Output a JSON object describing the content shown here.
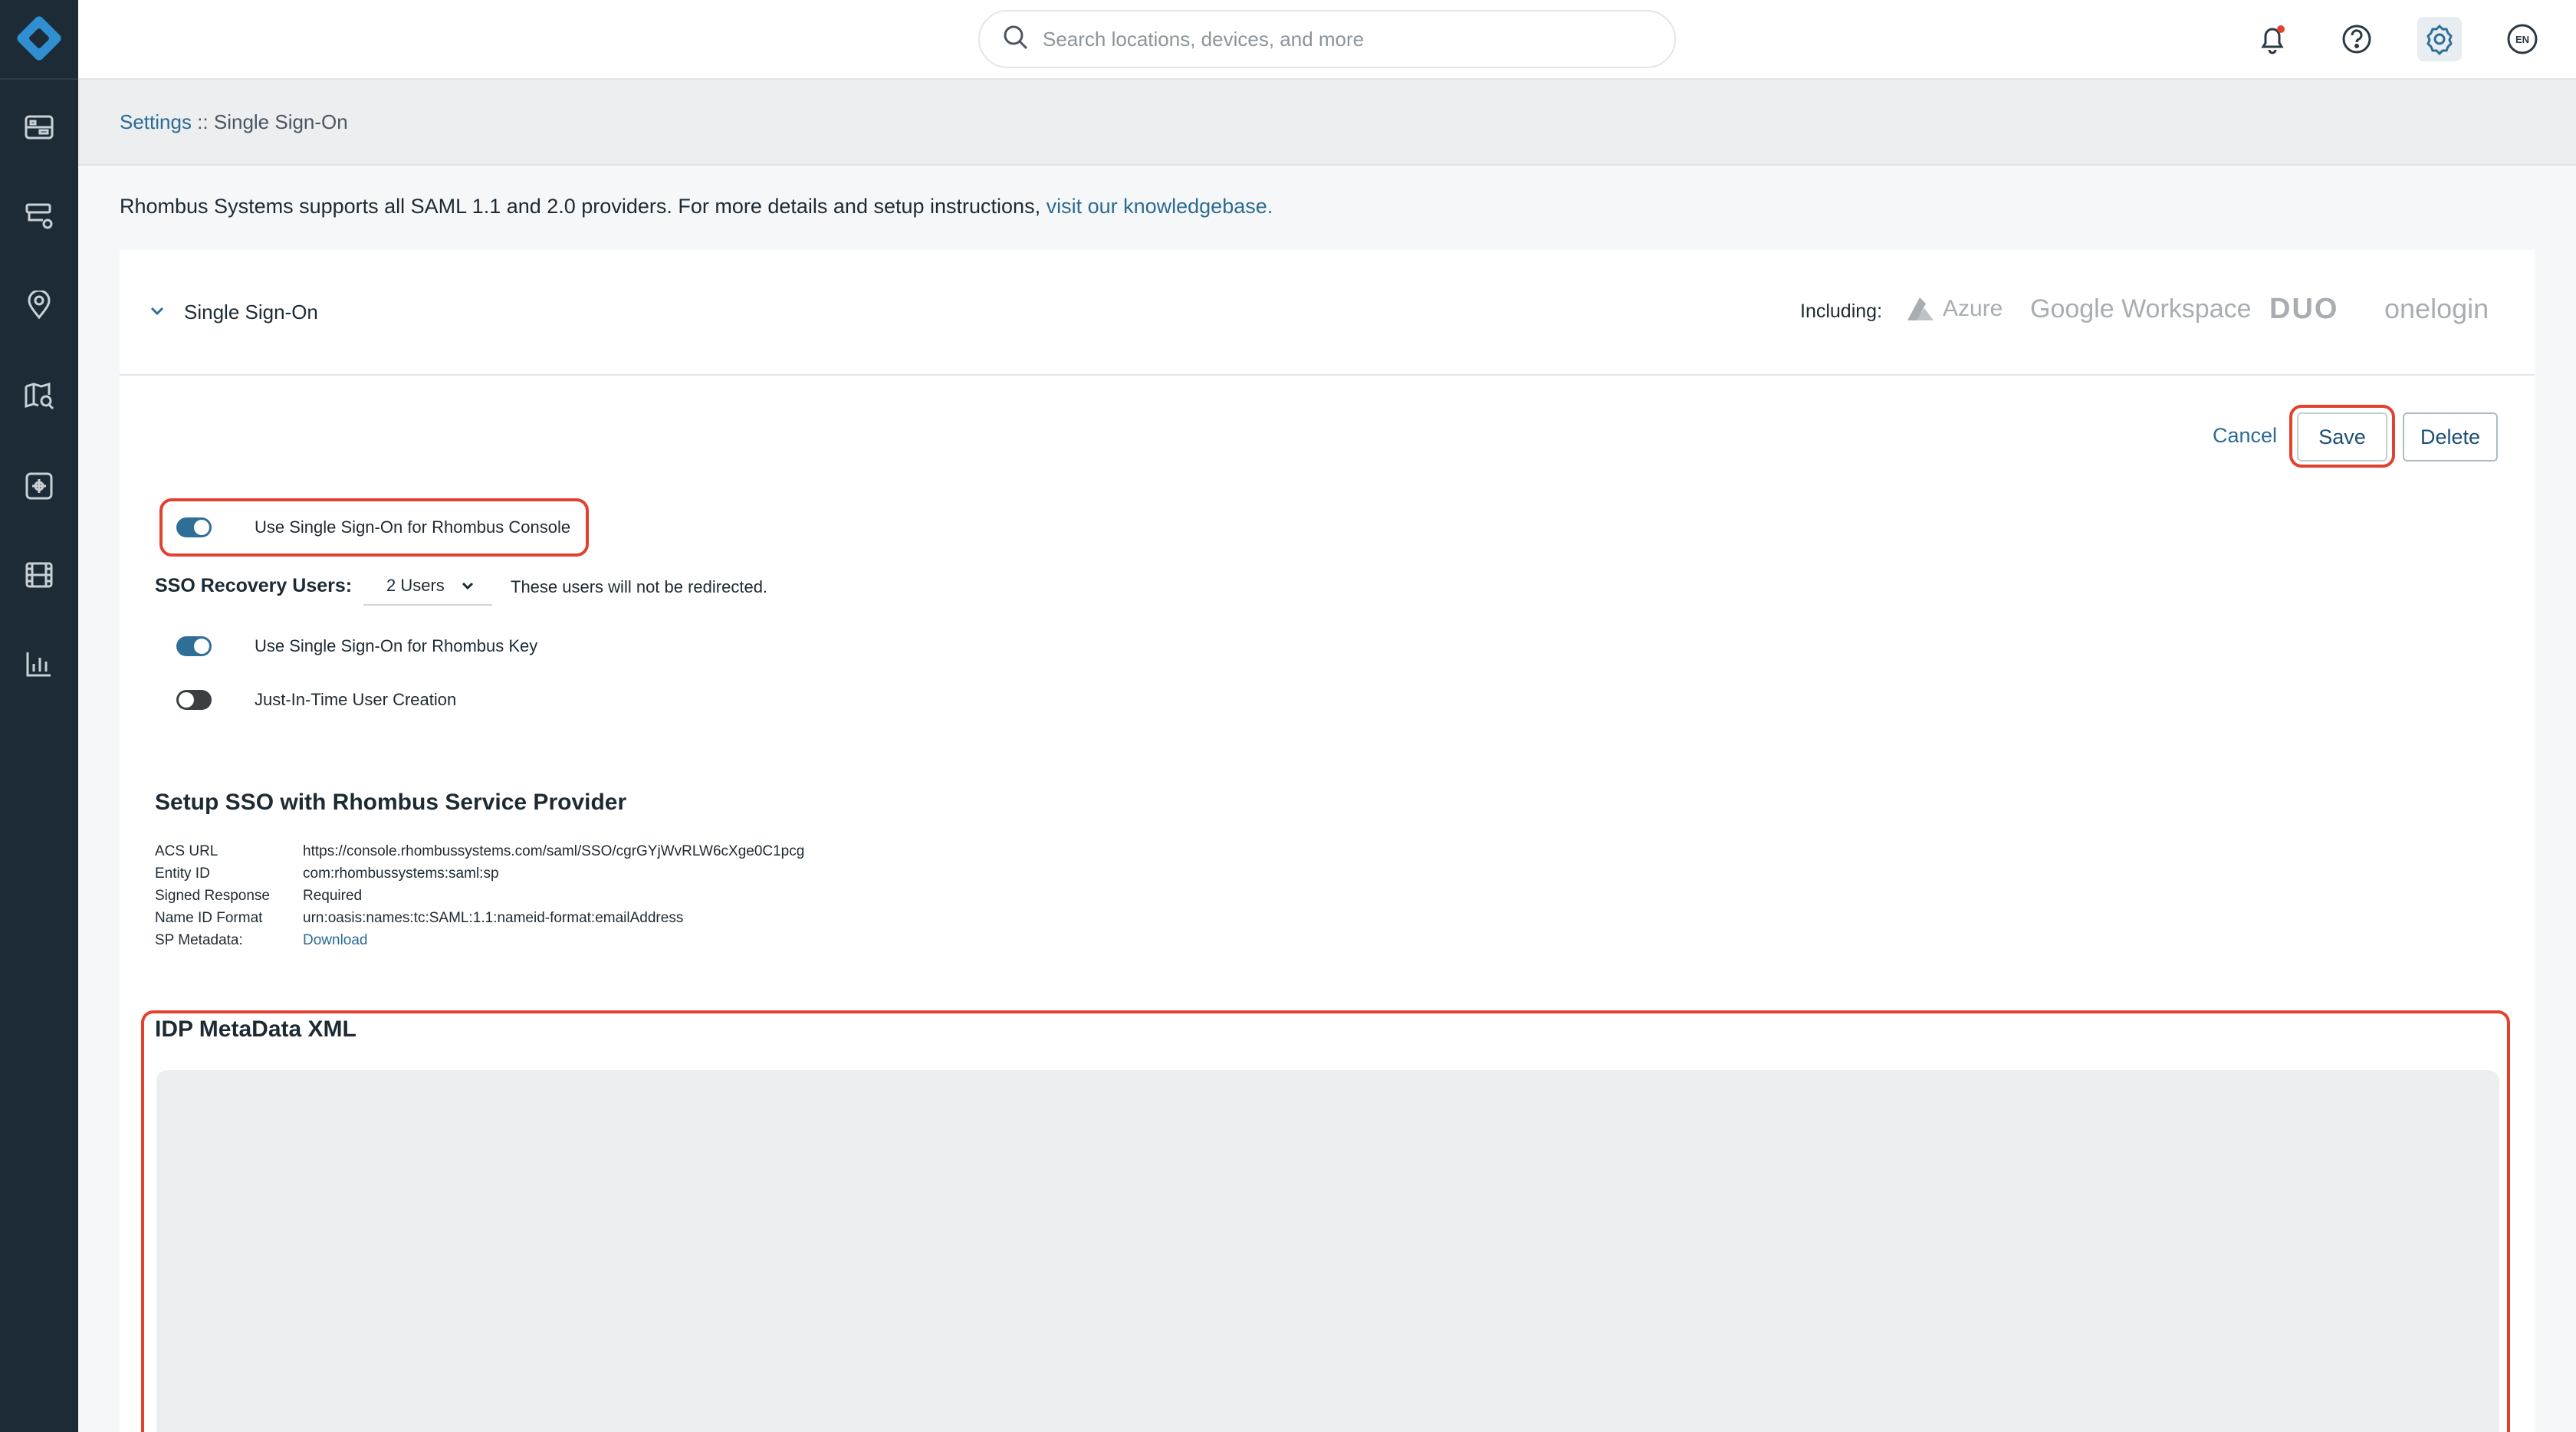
{
  "search": {
    "placeholder": "Search locations, devices, and more"
  },
  "header": {
    "language": "EN"
  },
  "breadcrumb": {
    "root": "Settings",
    "separator": " :: ",
    "current": "Single Sign-On"
  },
  "intro": {
    "text": "Rhombus Systems supports all SAML 1.1 and 2.0 providers. For more details and setup instructions, ",
    "link": "visit our knowledgebase."
  },
  "card": {
    "title": "Single Sign-On",
    "including_label": "Including:",
    "brands": [
      "Azure",
      "Google Workspace",
      "DUO",
      "onelogin"
    ]
  },
  "actions": {
    "cancel": "Cancel",
    "save": "Save",
    "delete": "Delete"
  },
  "toggles": [
    {
      "label": "Use Single Sign-On for Rhombus Console",
      "on": true
    },
    {
      "label": "Use Single Sign-On for Rhombus Key",
      "on": true
    },
    {
      "label": "Just-In-Time User Creation",
      "on": false
    }
  ],
  "recovery": {
    "label": "SSO Recovery Users:",
    "selected": "2 Users",
    "note": "These users will not be redirected."
  },
  "setup": {
    "title": "Setup SSO with Rhombus Service Provider",
    "rows": [
      {
        "key": "ACS URL",
        "value": "https://console.rhombussystems.com/saml/SSO/cgrGYjWvRLW6cXge0C1pcg"
      },
      {
        "key": "Entity ID",
        "value": "com:rhombussystems:saml:sp"
      },
      {
        "key": "Signed Response",
        "value": "Required"
      },
      {
        "key": "Name ID Format",
        "value": "urn:oasis:names:tc:SAML:1.1:nameid-format:emailAddress"
      },
      {
        "key": "SP Metadata:",
        "value": "Download"
      }
    ]
  },
  "idp": {
    "title": "IDP MetaData XML",
    "value": ""
  },
  "colors": {
    "sidebar": "#1c2b36",
    "accent": "#2f6f97",
    "link": "#2b6b94",
    "highlight": "#e2412f"
  },
  "icons": [
    "logo-icon",
    "dashboard-icon",
    "devices-icon",
    "location-icon",
    "map-search-icon",
    "integrations-icon",
    "video-icon",
    "reports-icon",
    "search-icon",
    "bell-icon",
    "help-icon",
    "gear-icon",
    "chevron-down-icon"
  ]
}
